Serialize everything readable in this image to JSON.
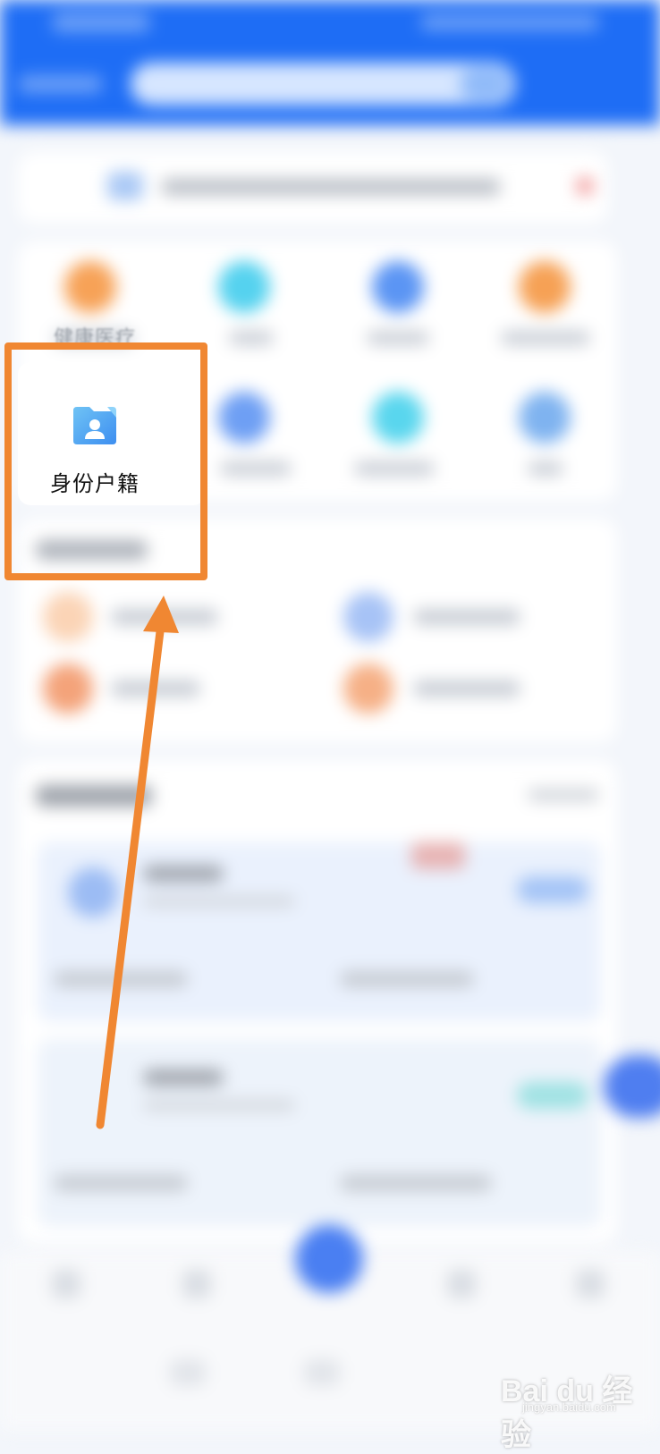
{
  "focused_item": {
    "label": "身份户籍",
    "icon": "id-card-folder-icon"
  },
  "blurred_partial_label": "健康医疗",
  "watermark": {
    "brand": "Bai du 经验",
    "sub": "jingyan.baidu.com"
  },
  "colors": {
    "header_blue": "#1e6df5",
    "highlight_orange": "#f08732",
    "page_bg": "#f3f6fb"
  }
}
